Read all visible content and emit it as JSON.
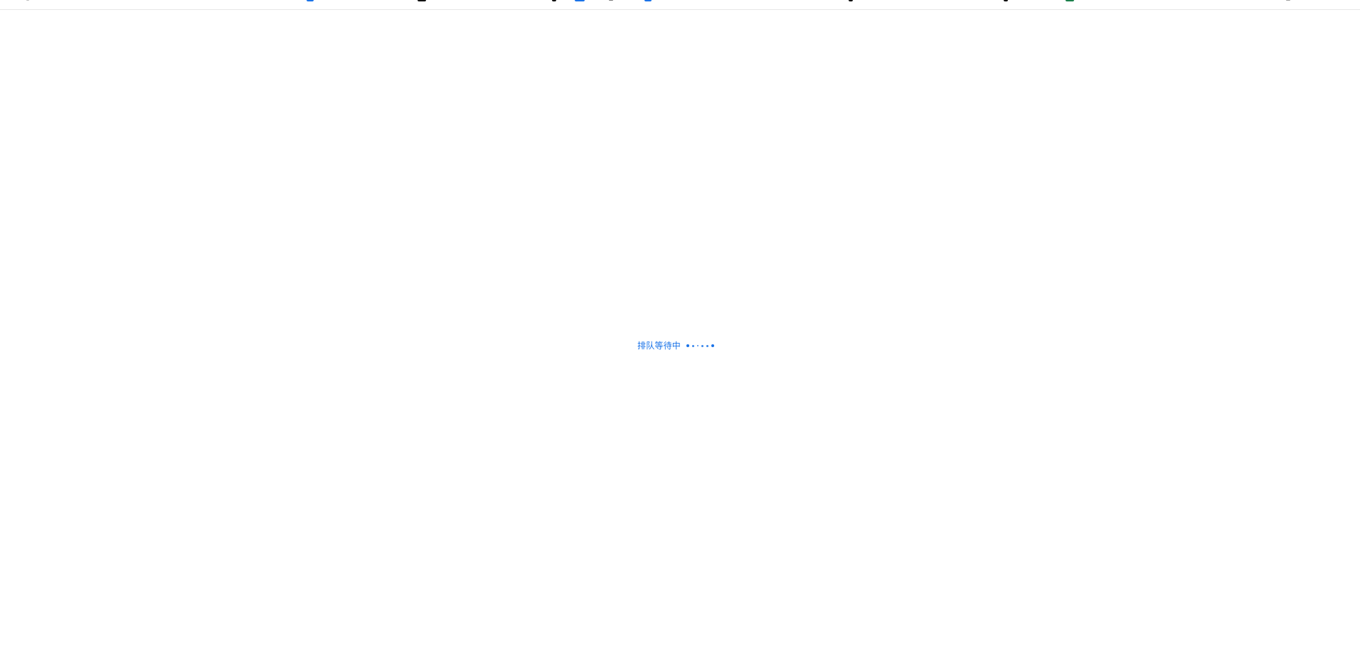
{
  "status": {
    "text": "排队等待中",
    "color": "#1a73e8"
  },
  "loading_indicator": {
    "type": "dots",
    "dot_count": 6
  },
  "top_bar": {
    "visible_fragments": [
      "cropped-icon-1",
      "cropped-icon-2",
      "cropped-icon-3",
      "cropped-icon-4",
      "cropped-icon-5",
      "cropped-icon-6",
      "cropped-icon-7",
      "cropped-icon-8",
      "cropped-icon-9",
      "cropped-icon-10",
      "cropped-icon-11"
    ]
  }
}
